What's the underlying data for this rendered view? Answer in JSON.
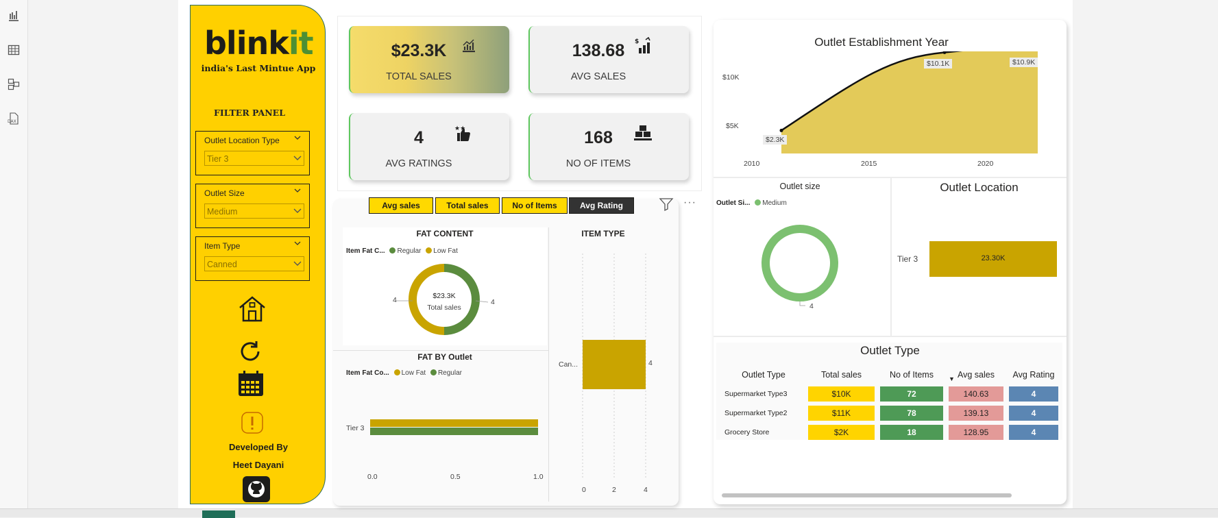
{
  "app": {
    "logo": {
      "prefix": "blink",
      "suffix": "it"
    },
    "tagline": "india's Last Mintue App",
    "colors": {
      "brand_yellow": "#ffd000",
      "brand_green": "#4d8f34",
      "bar_gold": "#c9a400",
      "regular_green": "#5b8c3e",
      "low_fat_gold": "#c9a400",
      "medium_green": "#7cc070"
    }
  },
  "rail": {
    "icons": [
      "report-view-icon",
      "table-view-icon",
      "model-view-icon",
      "dax-query-icon"
    ]
  },
  "filter_panel": {
    "title": "FILTER PANEL",
    "slicers": [
      {
        "label": "Outlet Location Type",
        "value": "Tier 3"
      },
      {
        "label": "Outlet Size",
        "value": "Medium"
      },
      {
        "label": "Item Type",
        "value": "Canned"
      }
    ],
    "nav_icons": [
      "home-icon",
      "refresh-icon",
      "calendar-icon",
      "info-icon"
    ],
    "developed_by_label": "Developed By",
    "developer_name": "Heet Dayani",
    "github_icon": "github-icon"
  },
  "kpis": [
    {
      "value": "$23.3K",
      "caption": "TOTAL SALES",
      "icon": "sales-chart-icon"
    },
    {
      "value": "138.68",
      "caption": "AVG SALES",
      "icon": "dollar-bars-icon"
    },
    {
      "value": "4",
      "caption": "AVG RATINGS",
      "icon": "thumbs-up-stars-icon"
    },
    {
      "value": "168",
      "caption": "NO OF ITEMS",
      "icon": "stacked-boxes-icon"
    }
  ],
  "metric_buttons": [
    "Avg sales",
    "Total sales",
    "No of Items",
    "Avg Rating"
  ],
  "active_metric": "Avg Rating",
  "toolbar": {
    "filter_icon": "filter-icon",
    "more": "···"
  },
  "charts": {
    "fat_content": {
      "title": "FAT CONTENT",
      "legend_title": "Item Fat C...",
      "legend": [
        "Regular",
        "Low Fat"
      ],
      "center_value": "$23.3K",
      "center_label": "Total sales",
      "left_label": "4",
      "right_label": "4"
    },
    "item_type": {
      "title": "ITEM TYPE",
      "category": "Can...",
      "bar_label": "4",
      "ticks": [
        "0",
        "2",
        "4"
      ]
    },
    "fat_by_outlet": {
      "title": "FAT BY Outlet",
      "legend_title": "Item Fat Co...",
      "legend": [
        "Low Fat",
        "Regular"
      ],
      "category": "Tier 3",
      "ticks": [
        "0.0",
        "0.5",
        "1.0"
      ]
    },
    "establishment": {
      "title": "Outlet Establishment Year",
      "y_ticks": [
        "$10K",
        "$5K"
      ],
      "x_ticks": [
        "2010",
        "2015",
        "2020"
      ],
      "point_labels": [
        "$2.3K",
        "$10.1K",
        "$10.9K"
      ]
    },
    "outlet_size": {
      "title": "Outlet size",
      "legend_title": "Outlet Si...",
      "legend": [
        "Medium"
      ],
      "label": "4"
    },
    "outlet_location": {
      "title": "Outlet Location",
      "category": "Tier 3",
      "bar_label": "23.30K"
    }
  },
  "chart_data": [
    {
      "type": "pie",
      "title": "FAT CONTENT",
      "categories": [
        "Regular",
        "Low Fat"
      ],
      "values": [
        4,
        4
      ],
      "center_text": "$23.3K Total sales"
    },
    {
      "type": "bar",
      "title": "ITEM TYPE",
      "categories": [
        "Can..."
      ],
      "values": [
        4
      ],
      "xlim": [
        0,
        4
      ],
      "orientation": "horizontal"
    },
    {
      "type": "bar",
      "title": "FAT BY Outlet",
      "categories": [
        "Tier 3"
      ],
      "series": [
        {
          "name": "Low Fat",
          "values": [
            1.0
          ]
        },
        {
          "name": "Regular",
          "values": [
            1.0
          ]
        }
      ],
      "xlim": [
        0,
        1.0
      ],
      "orientation": "horizontal"
    },
    {
      "type": "area",
      "title": "Outlet Establishment Year",
      "x": [
        2011,
        2018,
        2022
      ],
      "values": [
        2300,
        10100,
        10900
      ],
      "point_labels": [
        "$2.3K",
        "$10.1K",
        "$10.9K"
      ],
      "xlim": [
        2010,
        2022
      ],
      "ylim": [
        0,
        11000
      ]
    },
    {
      "type": "pie",
      "title": "Outlet size",
      "categories": [
        "Medium"
      ],
      "values": [
        4
      ]
    },
    {
      "type": "bar",
      "title": "Outlet Location",
      "categories": [
        "Tier 3"
      ],
      "values": [
        23300
      ],
      "orientation": "horizontal"
    }
  ],
  "outlet_type": {
    "title": "Outlet Type",
    "columns": [
      "Outlet Type",
      "Total sales",
      "No of Items",
      "Avg sales",
      "Avg Rating"
    ],
    "rows": [
      [
        "Supermarket Type3",
        "$10K",
        "72",
        "140.63",
        "4"
      ],
      [
        "Supermarket Type2",
        "$11K",
        "78",
        "139.13",
        "4"
      ],
      [
        "Grocery Store",
        "$2K",
        "18",
        "128.95",
        "4"
      ]
    ],
    "cell_colors": {
      "total_sales": "#ffd400",
      "items": "#4e9a56",
      "avg_sales": "#e39a98",
      "rating": "#5b86b3"
    }
  }
}
